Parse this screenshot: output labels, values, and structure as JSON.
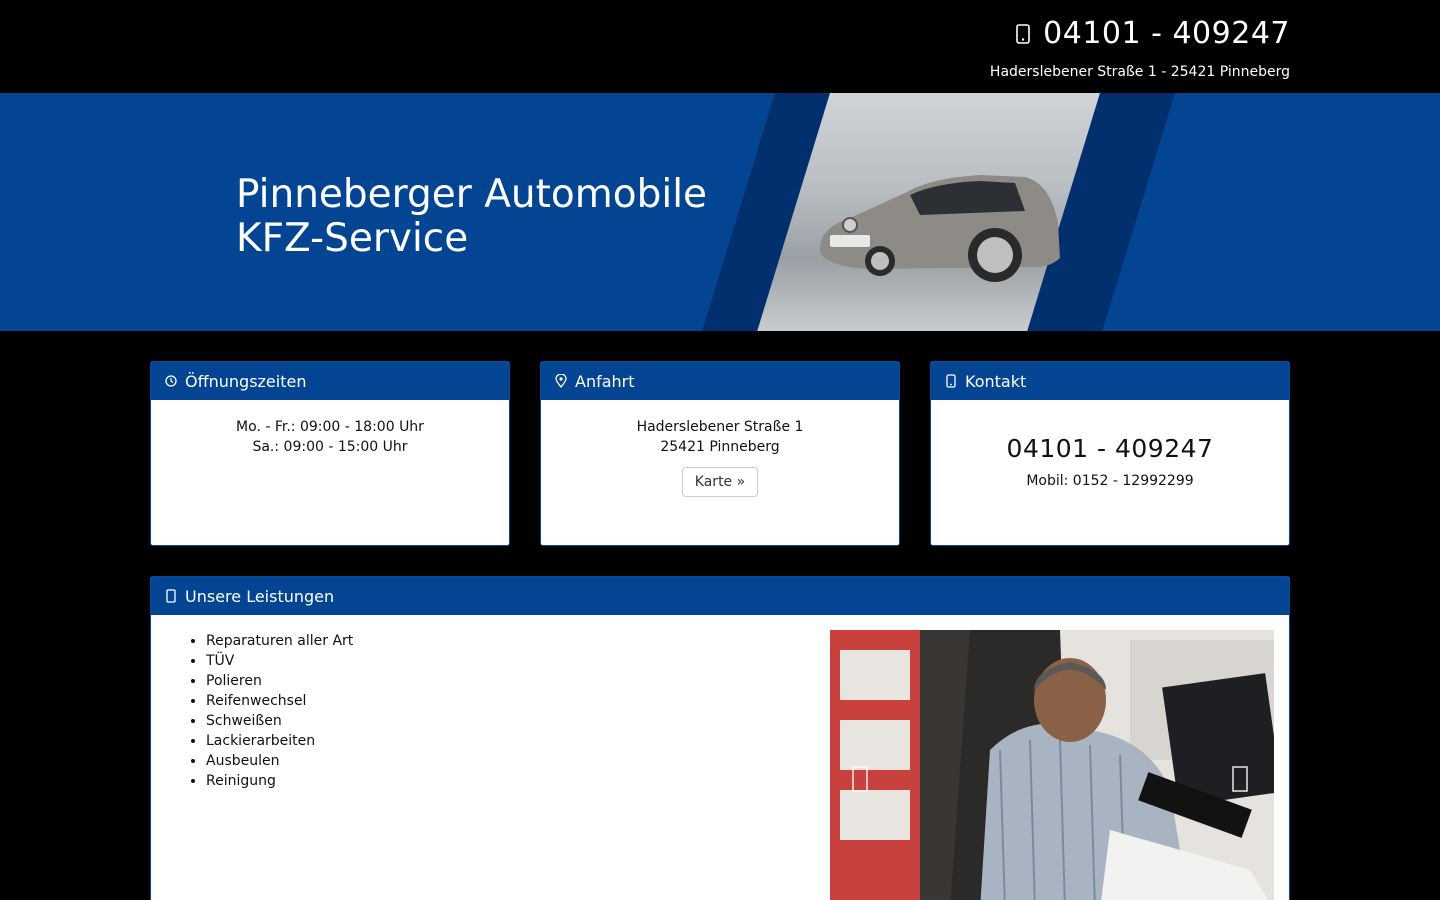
{
  "header": {
    "phone": "04101 - 409247",
    "phone_icon": "phone-icon",
    "address": "Haderslebener Straße 1 - 25421 Pinneberg"
  },
  "hero": {
    "title_line1": "Pinneberger Automobile",
    "title_line2": "KFZ-Service",
    "accent_color": "#034592"
  },
  "cards": {
    "hours": {
      "title": "Öffnungszeiten",
      "icon": "clock-icon",
      "line1": "Mo. - Fr.: 09:00 - 18:00 Uhr",
      "line2": "Sa.: 09:00 - 15:00 Uhr"
    },
    "directions": {
      "title": "Anfahrt",
      "icon": "map-marker-icon",
      "street": "Haderslebener Straße 1",
      "city": "25421 Pinneberg",
      "button": "Karte »"
    },
    "contact": {
      "title": "Kontakt",
      "icon": "phone-icon",
      "phone": "04101 - 409247",
      "mobile": "Mobil: 0152 - 12992299"
    }
  },
  "services": {
    "title": "Unsere Leistungen",
    "icon": "wrench-icon",
    "items": [
      "Reparaturen aller Art",
      "TÜV",
      "Polieren",
      "Reifenwechsel",
      "Schweißen",
      "Lackierarbeiten",
      "Ausbeulen",
      "Reinigung"
    ],
    "carousel_prev_icon": "chevron-left-icon",
    "carousel_next_icon": "chevron-right-icon"
  }
}
